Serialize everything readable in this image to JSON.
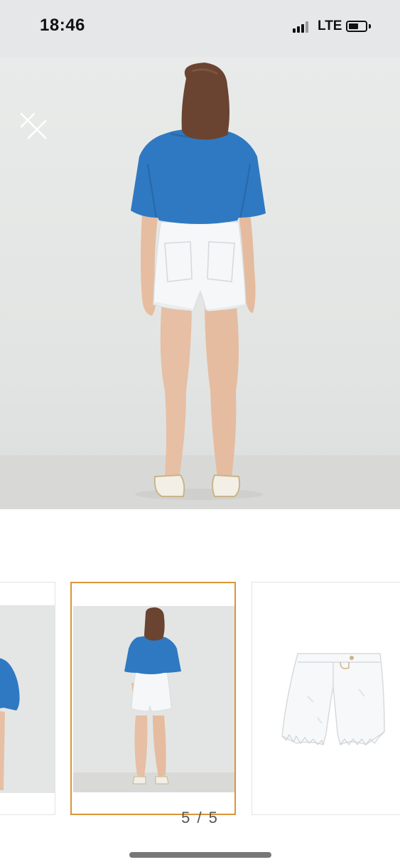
{
  "status_bar": {
    "time": "18:46",
    "network": "LTE",
    "icons": [
      "signal-icon",
      "battery-icon"
    ]
  },
  "gallery": {
    "close_icon": "close-icon",
    "counter": "5 / 5",
    "thumbnails": [
      {
        "name": "model-front-thumbnail",
        "active": false
      },
      {
        "name": "model-back-thumbnail",
        "active": true
      },
      {
        "name": "shorts-product-thumbnail",
        "active": false
      }
    ],
    "active_border_color": "#d9953b"
  }
}
